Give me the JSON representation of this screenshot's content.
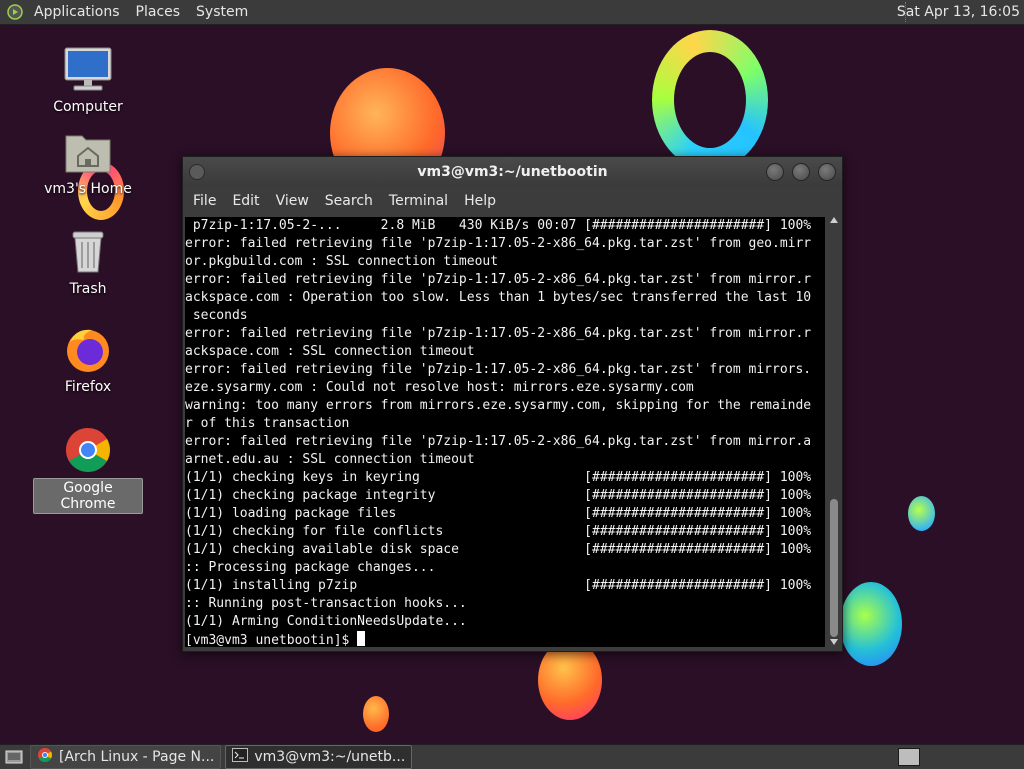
{
  "top_panel": {
    "menus": [
      "Applications",
      "Places",
      "System"
    ],
    "clock": "Sat Apr 13, 16:05"
  },
  "desktop_icons": [
    {
      "label": "Computer",
      "icon": "computer-icon"
    },
    {
      "label": "vm3's Home",
      "icon": "home-folder-icon"
    },
    {
      "label": "Trash",
      "icon": "trash-icon"
    },
    {
      "label": "Firefox",
      "icon": "firefox-icon"
    },
    {
      "label": "Google Chrome",
      "icon": "chrome-icon",
      "selected": true
    }
  ],
  "terminal": {
    "title": "vm3@vm3:~/unetbootin",
    "menus": [
      "File",
      "Edit",
      "View",
      "Search",
      "Terminal",
      "Help"
    ],
    "lines": [
      " p7zip-1:17.05-2-...     2.8 MiB   430 KiB/s 00:07 [######################] 100%",
      "error: failed retrieving file 'p7zip-1:17.05-2-x86_64.pkg.tar.zst' from geo.mirr",
      "or.pkgbuild.com : SSL connection timeout",
      "error: failed retrieving file 'p7zip-1:17.05-2-x86_64.pkg.tar.zst' from mirror.r",
      "ackspace.com : Operation too slow. Less than 1 bytes/sec transferred the last 10",
      " seconds",
      "error: failed retrieving file 'p7zip-1:17.05-2-x86_64.pkg.tar.zst' from mirror.r",
      "ackspace.com : SSL connection timeout",
      "error: failed retrieving file 'p7zip-1:17.05-2-x86_64.pkg.tar.zst' from mirrors.",
      "eze.sysarmy.com : Could not resolve host: mirrors.eze.sysarmy.com",
      "warning: too many errors from mirrors.eze.sysarmy.com, skipping for the remainde",
      "r of this transaction",
      "error: failed retrieving file 'p7zip-1:17.05-2-x86_64.pkg.tar.zst' from mirror.a",
      "arnet.edu.au : SSL connection timeout",
      "(1/1) checking keys in keyring                     [######################] 100%",
      "(1/1) checking package integrity                   [######################] 100%",
      "(1/1) loading package files                        [######################] 100%",
      "(1/1) checking for file conflicts                  [######################] 100%",
      "(1/1) checking available disk space                [######################] 100%",
      ":: Processing package changes...",
      "(1/1) installing p7zip                             [######################] 100%",
      ":: Running post-transaction hooks...",
      "(1/1) Arming ConditionNeedsUpdate..."
    ],
    "prompt": "[vm3@vm3 unetbootin]$ "
  },
  "taskbar": {
    "tasks": [
      {
        "label": "[Arch Linux - Page N...",
        "icon": "chrome-icon",
        "active": false
      },
      {
        "label": "vm3@vm3:~/unetb...",
        "icon": "terminal-icon",
        "active": true
      }
    ]
  }
}
